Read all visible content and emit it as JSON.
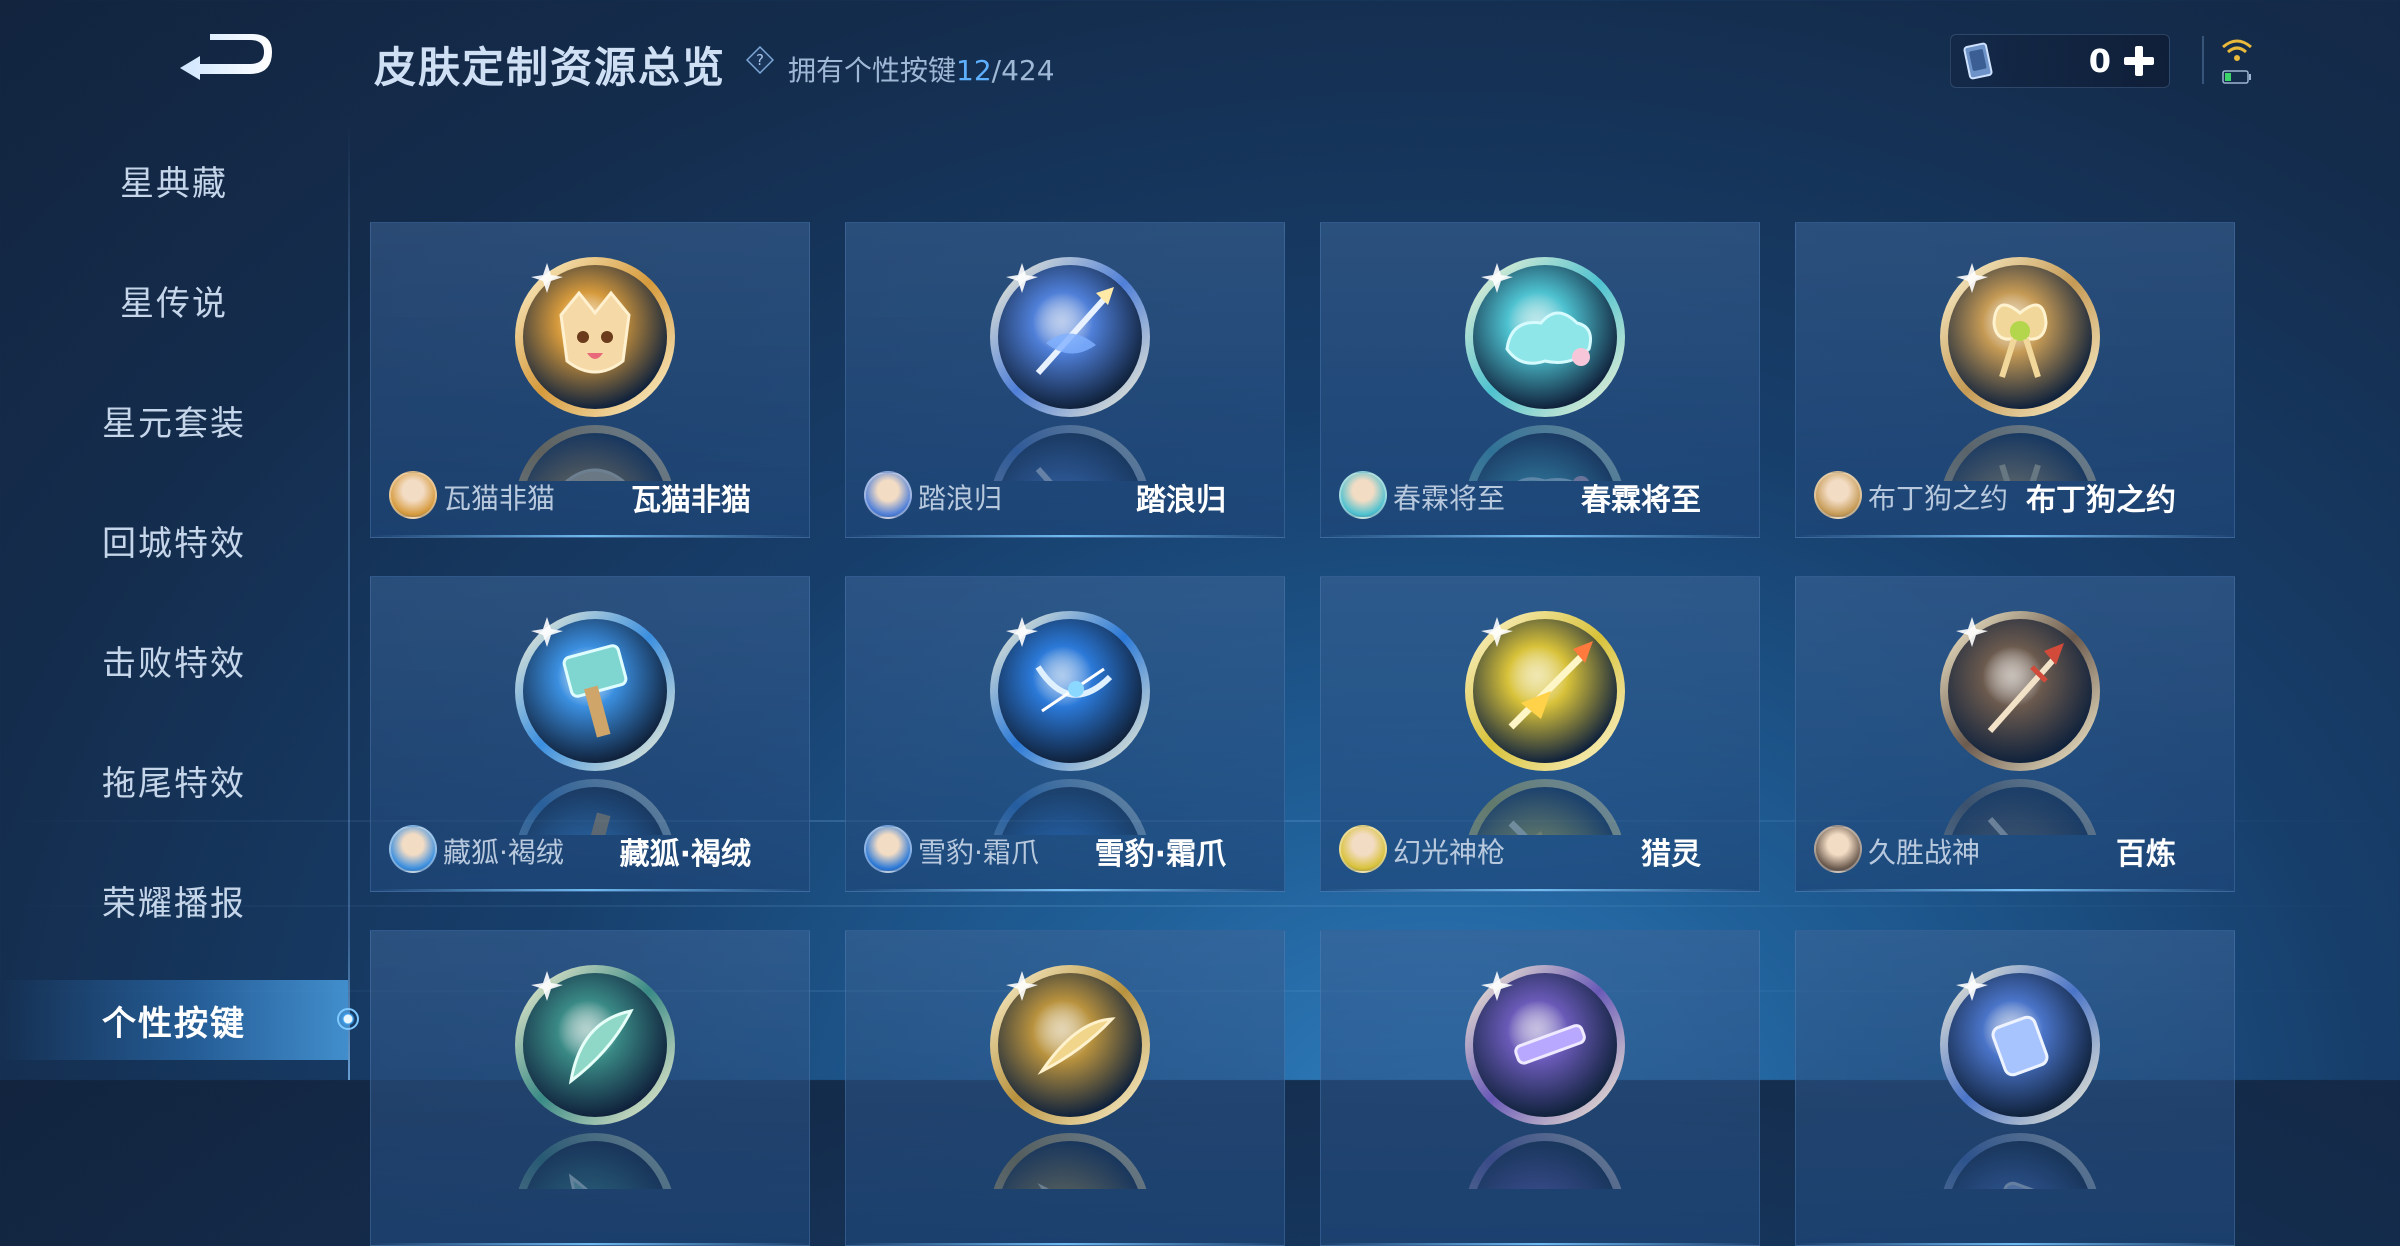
{
  "header": {
    "title": "皮肤定制资源总览",
    "owned_label": "拥有个性按键",
    "owned_count": "12",
    "owned_total": "/424"
  },
  "currency": {
    "value": "0",
    "icon": "voucher-card-icon"
  },
  "sidebar": {
    "items": [
      {
        "label": "星典藏"
      },
      {
        "label": "星传说"
      },
      {
        "label": "星元套装"
      },
      {
        "label": "回城特效"
      },
      {
        "label": "击败特效"
      },
      {
        "label": "拖尾特效"
      },
      {
        "label": "荣耀播报"
      },
      {
        "label": "个性按键",
        "active": true
      }
    ]
  },
  "cards": [
    {
      "hero": "瓦猫非猫",
      "key": "瓦猫非猫",
      "emblem": "golden-cat-mask-icon",
      "color": "#d69a3c"
    },
    {
      "hero": "踏浪归",
      "key": "踏浪归",
      "emblem": "wave-spear-icon",
      "color": "#4f7fd8"
    },
    {
      "hero": "春霖将至",
      "key": "春霖将至",
      "emblem": "jade-cloud-icon",
      "color": "#4ec2d0"
    },
    {
      "hero": "布丁狗之约",
      "key": "布丁狗之约",
      "emblem": "ribbon-bow-icon",
      "color": "#c59a55"
    },
    {
      "hero": "藏狐·褐绒",
      "key": "藏狐·褐绒",
      "emblem": "jade-hammer-icon",
      "color": "#3b8fe0"
    },
    {
      "hero": "雪豹·霜爪",
      "key": "雪豹·霜爪",
      "emblem": "ice-bow-icon",
      "color": "#2b79d8"
    },
    {
      "hero": "幻光神枪",
      "key": "猎灵",
      "emblem": "light-spear-icon",
      "color": "#d8c23a"
    },
    {
      "hero": "久胜战神",
      "key": "百炼",
      "emblem": "war-trident-icon",
      "color": "#6b5a4e"
    },
    {
      "hero": "",
      "key": "",
      "emblem": "teal-blade-icon",
      "color": "#3a8a86"
    },
    {
      "hero": "",
      "key": "",
      "emblem": "golden-saber-icon",
      "color": "#b8923e"
    },
    {
      "hero": "",
      "key": "",
      "emblem": "violet-gun-icon",
      "color": "#6a5ab8"
    },
    {
      "hero": "",
      "key": "",
      "emblem": "mech-gauntlet-icon",
      "color": "#4a74c8"
    }
  ]
}
